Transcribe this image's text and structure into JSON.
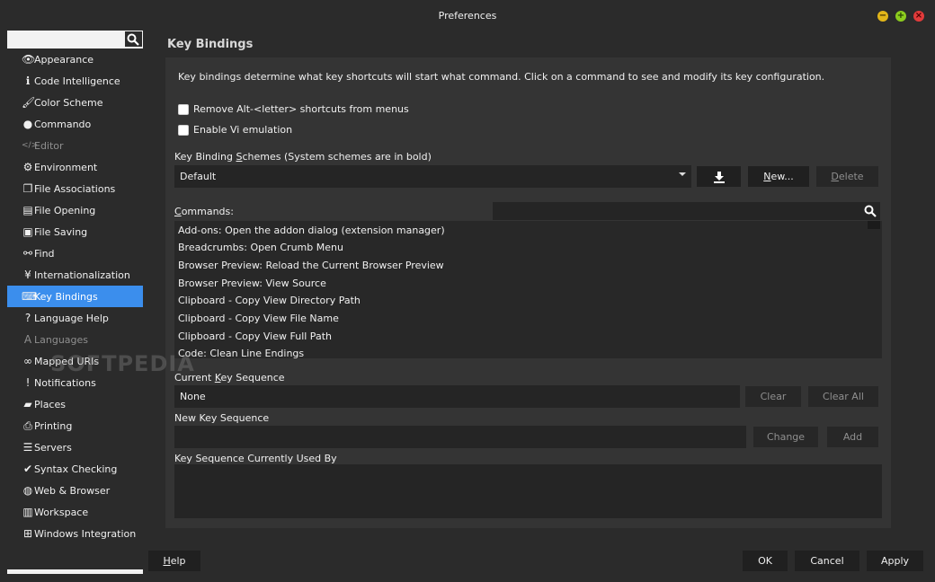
{
  "window": {
    "title": "Preferences",
    "controls": [
      {
        "name": "minimize",
        "glyph": "−"
      },
      {
        "name": "maximize",
        "glyph": "+"
      },
      {
        "name": "close",
        "glyph": "×"
      }
    ]
  },
  "sidebar": {
    "search_placeholder": "",
    "items": [
      {
        "label": "Appearance",
        "icon": "eye-icon",
        "glyph": "👁",
        "state": "normal"
      },
      {
        "label": "Code Intelligence",
        "icon": "info-icon",
        "glyph": "ℹ",
        "state": "normal"
      },
      {
        "label": "Color Scheme",
        "icon": "paintbrush-icon",
        "glyph": "🖌",
        "state": "normal"
      },
      {
        "label": "Commando",
        "icon": "user-icon",
        "glyph": "●",
        "state": "normal"
      },
      {
        "label": "Editor",
        "icon": "code-icon",
        "glyph": "</>",
        "state": "disabled"
      },
      {
        "label": "Environment",
        "icon": "gear-icon",
        "glyph": "⚙",
        "state": "normal"
      },
      {
        "label": "File Associations",
        "icon": "files-icon",
        "glyph": "❐",
        "state": "normal"
      },
      {
        "label": "File Opening",
        "icon": "file-icon",
        "glyph": "▤",
        "state": "normal"
      },
      {
        "label": "File Saving",
        "icon": "save-icon",
        "glyph": "▣",
        "state": "normal"
      },
      {
        "label": "Find",
        "icon": "binoculars-icon",
        "glyph": "⚯",
        "state": "normal"
      },
      {
        "label": "Internationalization",
        "icon": "yen-icon",
        "glyph": "¥",
        "state": "normal"
      },
      {
        "label": "Key Bindings",
        "icon": "keyboard-icon",
        "glyph": "⌨",
        "state": "selected"
      },
      {
        "label": "Language Help",
        "icon": "question-icon",
        "glyph": "?",
        "state": "normal"
      },
      {
        "label": "Languages",
        "icon": "language-icon",
        "glyph": "A",
        "state": "disabled"
      },
      {
        "label": "Mapped URIs",
        "icon": "link-icon",
        "glyph": "∞",
        "state": "normal"
      },
      {
        "label": "Notifications",
        "icon": "alert-icon",
        "glyph": "!",
        "state": "normal"
      },
      {
        "label": "Places",
        "icon": "folder-icon",
        "glyph": "▰",
        "state": "normal"
      },
      {
        "label": "Printing",
        "icon": "printer-icon",
        "glyph": "⎙",
        "state": "normal"
      },
      {
        "label": "Servers",
        "icon": "server-icon",
        "glyph": "☰",
        "state": "normal"
      },
      {
        "label": "Syntax Checking",
        "icon": "check-icon",
        "glyph": "✔",
        "state": "normal"
      },
      {
        "label": "Web & Browser",
        "icon": "globe-icon",
        "glyph": "◍",
        "state": "normal"
      },
      {
        "label": "Workspace",
        "icon": "briefcase-icon",
        "glyph": "▥",
        "state": "normal"
      },
      {
        "label": "Windows Integration",
        "icon": "windows-icon",
        "glyph": "⊞",
        "state": "normal"
      }
    ]
  },
  "main": {
    "heading": "Key Bindings",
    "description": "Key bindings determine what key shortcuts will start what command. Click on a command to see and modify its key configuration.",
    "checkbox_alt": "Remove Alt-<letter> shortcuts from menus",
    "checkbox_vi": "Enable Vi emulation",
    "schemes_label_pre": "Key Binding ",
    "schemes_label_u": "S",
    "schemes_label_post": "chemes (System schemes are in bold)",
    "scheme_value": "Default",
    "download_icon": "download-icon",
    "new_pre": "",
    "new_u": "N",
    "new_post": "ew...",
    "delete_pre": "",
    "delete_u": "D",
    "delete_post": "elete",
    "commands_label_pre": "",
    "commands_label_u": "C",
    "commands_label_post": "ommands:",
    "commands_search_value": "",
    "commands": [
      "Add-ons: Open the addon dialog (extension manager)",
      "Breadcrumbs: Open Crumb Menu",
      "Browser Preview: Reload the Current Browser Preview",
      "Browser Preview: View Source",
      "Clipboard - Copy View Directory Path",
      "Clipboard - Copy View File Name",
      "Clipboard - Copy View Full Path",
      "Code: Clean Line Endings"
    ],
    "current_seq_label_pre": "Current ",
    "current_seq_label_u": "K",
    "current_seq_label_post": "ey Sequence",
    "current_seq_value": "None",
    "clear_label": "Clear",
    "clear_all_label": "Clear All",
    "new_seq_label": "New Key Sequence",
    "new_seq_value": "",
    "change_label": "Change",
    "add_label": "Add",
    "used_by_label": "Key Sequence Currently Used By"
  },
  "footer": {
    "help_pre": "",
    "help_u": "H",
    "help_post": "elp",
    "ok": "OK",
    "cancel": "Cancel",
    "apply": "Apply"
  },
  "watermark": "SOFTPEDIA"
}
